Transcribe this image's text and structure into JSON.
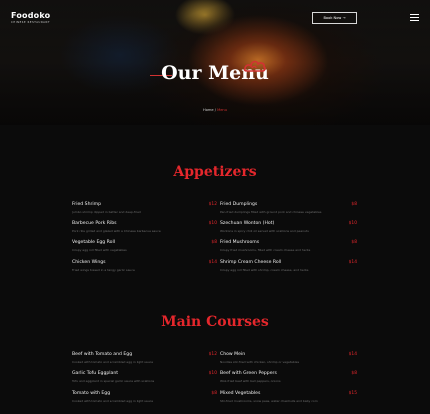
{
  "header": {
    "brand_name": "Foodoko",
    "brand_sub": "CHINESE RESTAURANT",
    "book_label": "Book Now  →",
    "menu_icon": "hamburger-icon"
  },
  "hero": {
    "title": "Our Menu",
    "breadcrumb_home": "Home / ",
    "breadcrumb_current": "Menu"
  },
  "sections": [
    {
      "title": "Appetizers",
      "items": [
        {
          "name": "Fried Shrimp",
          "desc": "Jumbo shrimp dipped in batter and deep-fried",
          "price": "$12"
        },
        {
          "name": "Fried Dumplings",
          "desc": "Pan-fried dumplings filled with ground pork and chinese vegetables",
          "price": "$8"
        },
        {
          "name": "Barbecue Pork Ribs",
          "desc": "Pork ribs grilled and glazed with a Chinese barbecue sauce",
          "price": "$10"
        },
        {
          "name": "Szechuan Wonton (Hot)",
          "desc": "Wontons in spicy chili oil served with scallions and peanuts",
          "price": "$10"
        },
        {
          "name": "Vegetable Egg Roll",
          "desc": "Crispy egg roll filled with vegetables",
          "price": "$8"
        },
        {
          "name": "Fried Mushrooms",
          "desc": "Crispy fried mushrooms, filled with cream cheese and herbs",
          "price": "$8"
        },
        {
          "name": "Chicken Wings",
          "desc": "Fried wings tossed in a tangy garlic sauce",
          "price": "$14"
        },
        {
          "name": "Shrimp Cream Cheese Roll",
          "desc": "Crispy egg roll filled with shrimp, cream cheese, and herbs",
          "price": "$14"
        }
      ]
    },
    {
      "title": "Main Courses",
      "items": [
        {
          "name": "Beef with Tomato and Egg",
          "desc": "Cooked with tomato and scrambled egg in light sauce",
          "price": "$12"
        },
        {
          "name": "Chow Mein",
          "desc": "Noodles stir-fried with chicken, shrimp or vegetables",
          "price": "$14"
        },
        {
          "name": "Garlic Tofu Eggplant",
          "desc": "Tofu and eggplant in special garlic sauce with scallions",
          "price": "$10"
        },
        {
          "name": "Beef with Green Peppers",
          "desc": "Wok-fried beef with bell peppers, onions",
          "price": "$8"
        },
        {
          "name": "Tomato with Egg",
          "desc": "Cooked with tomato and scrambled egg in light sauce",
          "price": "$8"
        },
        {
          "name": "Mixed Vegetables",
          "desc": "Stir-fried mushrooms, snow peas, water chestnuts and baby corn",
          "price": "$15"
        }
      ]
    }
  ],
  "colors": {
    "accent": "#e5272c",
    "background": "#0b0b0b"
  }
}
